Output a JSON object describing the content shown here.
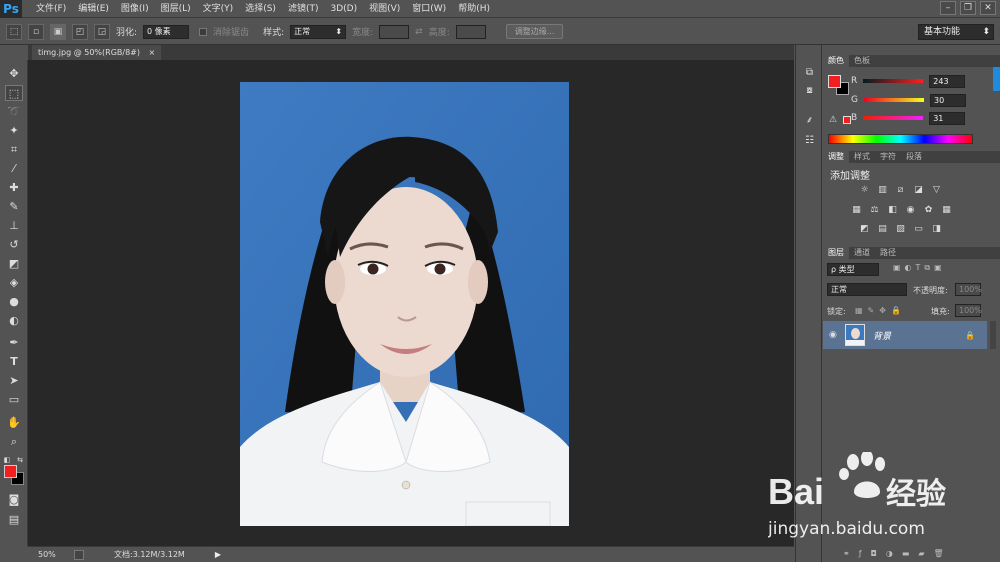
{
  "app": {
    "logo": "Ps"
  },
  "menu": [
    "文件(F)",
    "编辑(E)",
    "图像(I)",
    "图层(L)",
    "文字(Y)",
    "选择(S)",
    "滤镜(T)",
    "3D(D)",
    "视图(V)",
    "窗口(W)",
    "帮助(H)"
  ],
  "options_bar": {
    "feather_label": "羽化:",
    "feather_value": "0 像素",
    "antialias_label": "消除锯齿",
    "style_label": "样式:",
    "style_value": "正常",
    "width_label": "宽度:",
    "height_label": "高度:",
    "refine_edge_label": "调整边缘...",
    "workspace": "基本功能"
  },
  "document": {
    "tab_title": "timg.jpg @ 50%(RGB/8#)",
    "close": "×"
  },
  "statusbar": {
    "zoom": "50%",
    "doc_size": "文档:3.12M/3.12M"
  },
  "color_panel": {
    "tabs": [
      "颜色",
      "色板"
    ],
    "r_label": "R",
    "r_value": "243",
    "g_label": "G",
    "g_value": "30",
    "b_label": "B",
    "b_value": "31",
    "foreground": "#f31e1f",
    "background": "#000000"
  },
  "adjustments_panel": {
    "tabs": [
      "调整",
      "样式",
      "字符",
      "段落"
    ],
    "title": "添加调整"
  },
  "layers_panel": {
    "tabs": [
      "图层",
      "通道",
      "路径"
    ],
    "filter_kind": "ρ 类型",
    "blend_mode": "正常",
    "opacity_label": "不透明度:",
    "opacity_value": "100%",
    "lock_label": "锁定:",
    "fill_label": "填充:",
    "fill_value": "100%",
    "layer_name": "背景"
  },
  "watermark": {
    "brand": "Bai",
    "du": "du",
    "suffix": "经验",
    "url": "jingyan.baidu.com"
  }
}
